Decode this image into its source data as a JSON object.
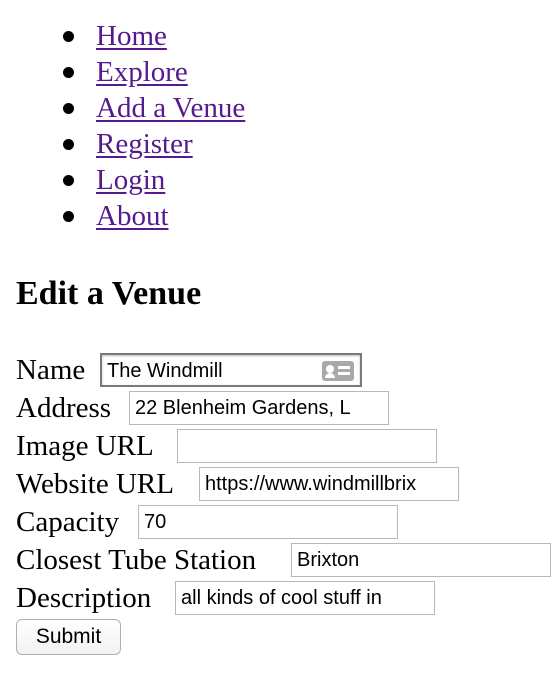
{
  "nav": {
    "items": [
      {
        "label": "Home"
      },
      {
        "label": "Explore"
      },
      {
        "label": "Add a Venue"
      },
      {
        "label": "Register"
      },
      {
        "label": "Login"
      },
      {
        "label": "About"
      }
    ]
  },
  "page": {
    "title": "Edit a Venue"
  },
  "form": {
    "name": {
      "label": "Name",
      "value": "The Windmill"
    },
    "address": {
      "label": "Address",
      "value": "22 Blenheim Gardens, L"
    },
    "image_url": {
      "label": "Image URL",
      "value": ""
    },
    "website_url": {
      "label": "Website URL",
      "value": "https://www.windmillbrix"
    },
    "capacity": {
      "label": "Capacity",
      "value": "70"
    },
    "closest_tube": {
      "label": "Closest Tube Station",
      "value": "Brixton"
    },
    "description": {
      "label": "Description",
      "value": "all kinds of cool stuff in"
    },
    "submit_label": "Submit"
  },
  "icons": {
    "autofill": "contact-card-icon"
  },
  "colors": {
    "link": "#551a8b"
  }
}
